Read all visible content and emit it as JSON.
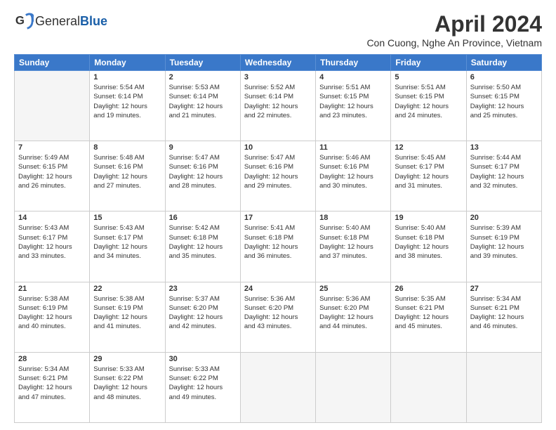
{
  "logo": {
    "general": "General",
    "blue": "Blue"
  },
  "title": "April 2024",
  "location": "Con Cuong, Nghe An Province, Vietnam",
  "days_of_week": [
    "Sunday",
    "Monday",
    "Tuesday",
    "Wednesday",
    "Thursday",
    "Friday",
    "Saturday"
  ],
  "weeks": [
    [
      {
        "day": null
      },
      {
        "day": "1",
        "sunrise": "5:54 AM",
        "sunset": "6:14 PM",
        "daylight": "12 hours and 19 minutes."
      },
      {
        "day": "2",
        "sunrise": "5:53 AM",
        "sunset": "6:14 PM",
        "daylight": "12 hours and 21 minutes."
      },
      {
        "day": "3",
        "sunrise": "5:52 AM",
        "sunset": "6:14 PM",
        "daylight": "12 hours and 22 minutes."
      },
      {
        "day": "4",
        "sunrise": "5:51 AM",
        "sunset": "6:15 PM",
        "daylight": "12 hours and 23 minutes."
      },
      {
        "day": "5",
        "sunrise": "5:51 AM",
        "sunset": "6:15 PM",
        "daylight": "12 hours and 24 minutes."
      },
      {
        "day": "6",
        "sunrise": "5:50 AM",
        "sunset": "6:15 PM",
        "daylight": "12 hours and 25 minutes."
      }
    ],
    [
      {
        "day": "7",
        "sunrise": "5:49 AM",
        "sunset": "6:15 PM",
        "daylight": "12 hours and 26 minutes."
      },
      {
        "day": "8",
        "sunrise": "5:48 AM",
        "sunset": "6:16 PM",
        "daylight": "12 hours and 27 minutes."
      },
      {
        "day": "9",
        "sunrise": "5:47 AM",
        "sunset": "6:16 PM",
        "daylight": "12 hours and 28 minutes."
      },
      {
        "day": "10",
        "sunrise": "5:47 AM",
        "sunset": "6:16 PM",
        "daylight": "12 hours and 29 minutes."
      },
      {
        "day": "11",
        "sunrise": "5:46 AM",
        "sunset": "6:16 PM",
        "daylight": "12 hours and 30 minutes."
      },
      {
        "day": "12",
        "sunrise": "5:45 AM",
        "sunset": "6:17 PM",
        "daylight": "12 hours and 31 minutes."
      },
      {
        "day": "13",
        "sunrise": "5:44 AM",
        "sunset": "6:17 PM",
        "daylight": "12 hours and 32 minutes."
      }
    ],
    [
      {
        "day": "14",
        "sunrise": "5:43 AM",
        "sunset": "6:17 PM",
        "daylight": "12 hours and 33 minutes."
      },
      {
        "day": "15",
        "sunrise": "5:43 AM",
        "sunset": "6:17 PM",
        "daylight": "12 hours and 34 minutes."
      },
      {
        "day": "16",
        "sunrise": "5:42 AM",
        "sunset": "6:18 PM",
        "daylight": "12 hours and 35 minutes."
      },
      {
        "day": "17",
        "sunrise": "5:41 AM",
        "sunset": "6:18 PM",
        "daylight": "12 hours and 36 minutes."
      },
      {
        "day": "18",
        "sunrise": "5:40 AM",
        "sunset": "6:18 PM",
        "daylight": "12 hours and 37 minutes."
      },
      {
        "day": "19",
        "sunrise": "5:40 AM",
        "sunset": "6:18 PM",
        "daylight": "12 hours and 38 minutes."
      },
      {
        "day": "20",
        "sunrise": "5:39 AM",
        "sunset": "6:19 PM",
        "daylight": "12 hours and 39 minutes."
      }
    ],
    [
      {
        "day": "21",
        "sunrise": "5:38 AM",
        "sunset": "6:19 PM",
        "daylight": "12 hours and 40 minutes."
      },
      {
        "day": "22",
        "sunrise": "5:38 AM",
        "sunset": "6:19 PM",
        "daylight": "12 hours and 41 minutes."
      },
      {
        "day": "23",
        "sunrise": "5:37 AM",
        "sunset": "6:20 PM",
        "daylight": "12 hours and 42 minutes."
      },
      {
        "day": "24",
        "sunrise": "5:36 AM",
        "sunset": "6:20 PM",
        "daylight": "12 hours and 43 minutes."
      },
      {
        "day": "25",
        "sunrise": "5:36 AM",
        "sunset": "6:20 PM",
        "daylight": "12 hours and 44 minutes."
      },
      {
        "day": "26",
        "sunrise": "5:35 AM",
        "sunset": "6:21 PM",
        "daylight": "12 hours and 45 minutes."
      },
      {
        "day": "27",
        "sunrise": "5:34 AM",
        "sunset": "6:21 PM",
        "daylight": "12 hours and 46 minutes."
      }
    ],
    [
      {
        "day": "28",
        "sunrise": "5:34 AM",
        "sunset": "6:21 PM",
        "daylight": "12 hours and 47 minutes."
      },
      {
        "day": "29",
        "sunrise": "5:33 AM",
        "sunset": "6:22 PM",
        "daylight": "12 hours and 48 minutes."
      },
      {
        "day": "30",
        "sunrise": "5:33 AM",
        "sunset": "6:22 PM",
        "daylight": "12 hours and 49 minutes."
      },
      {
        "day": null
      },
      {
        "day": null
      },
      {
        "day": null
      },
      {
        "day": null
      }
    ]
  ]
}
